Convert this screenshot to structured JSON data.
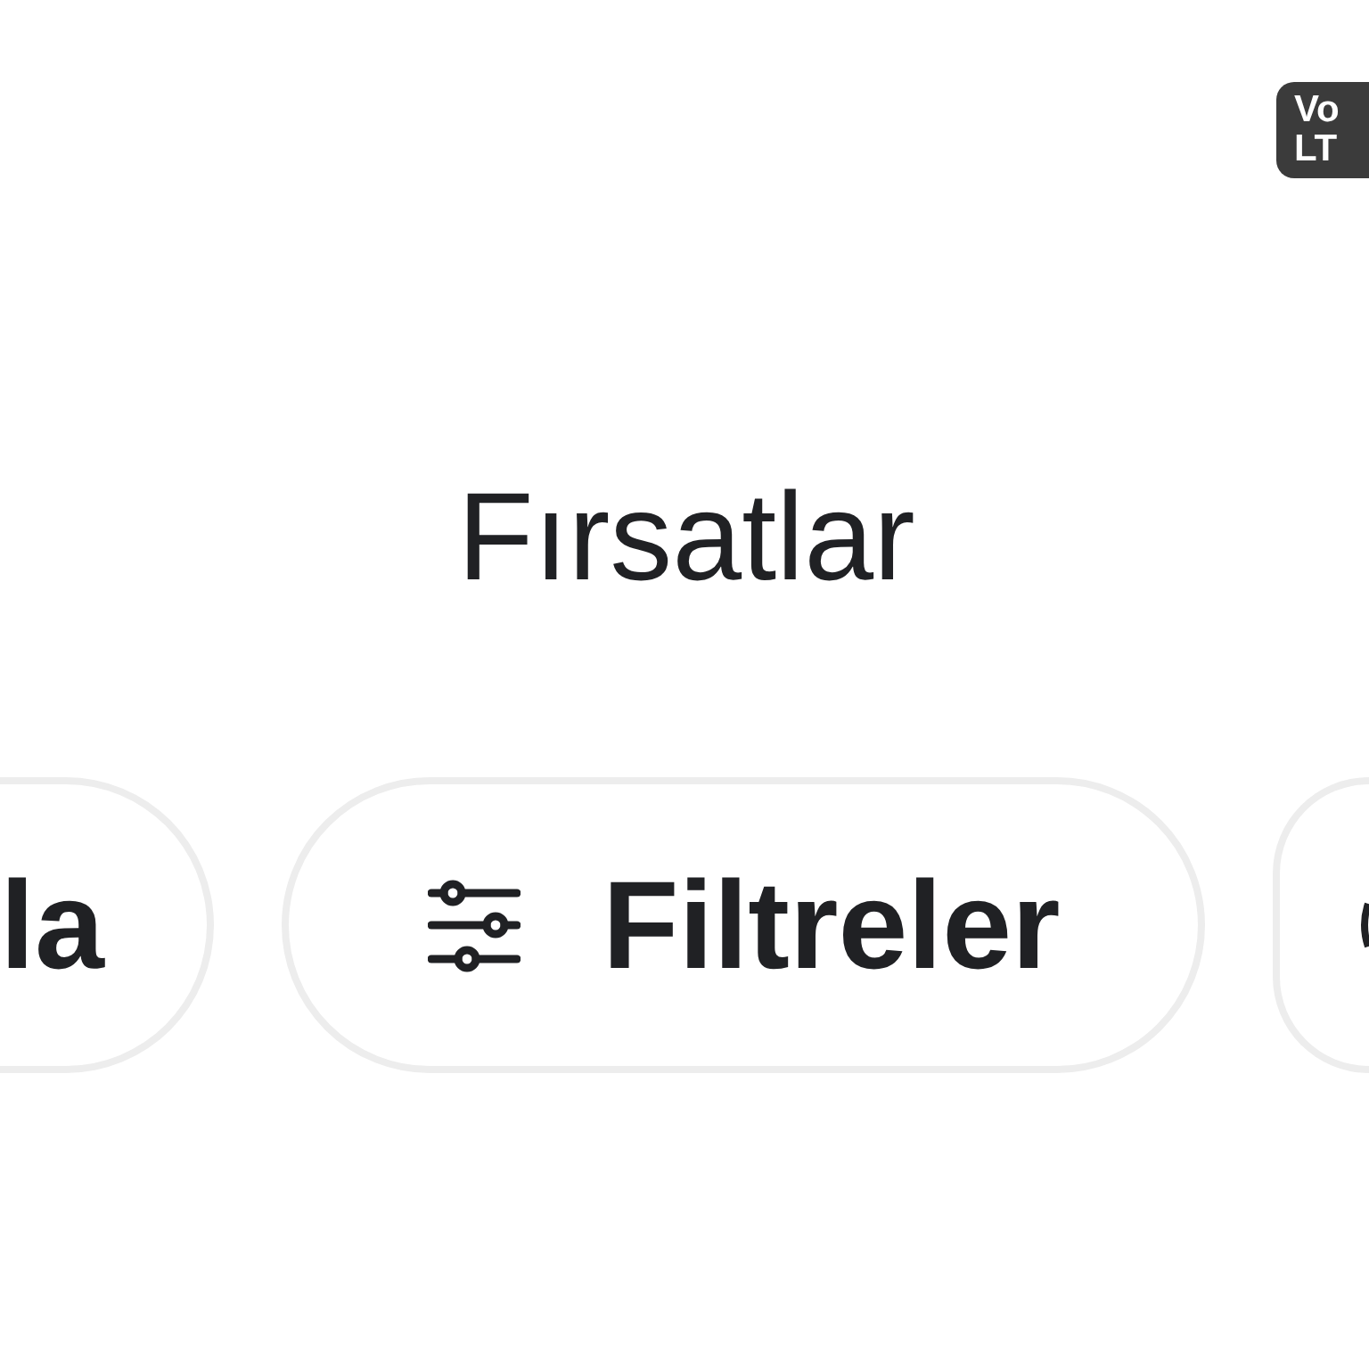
{
  "status_bar": {
    "network_badge": {
      "lines": [
        "Vo",
        "LT"
      ]
    }
  },
  "title": "Fırsatlar",
  "chips": [
    {
      "kind": "left-edge",
      "label": "la"
    },
    {
      "kind": "whole",
      "label": "Filtreler"
    },
    {
      "kind": "right-edge"
    }
  ]
}
